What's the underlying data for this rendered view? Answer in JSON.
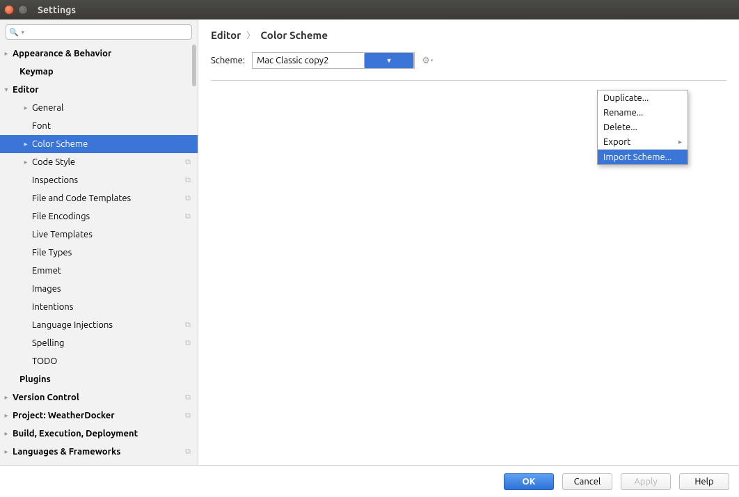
{
  "window": {
    "title": "Settings"
  },
  "sidebar": {
    "search_placeholder": "",
    "items": [
      {
        "label": "Appearance & Behavior",
        "level": 0,
        "bold": true,
        "arrow": "▸",
        "copy": false
      },
      {
        "label": "Keymap",
        "level": 1,
        "bold": true,
        "arrow": "",
        "copy": false
      },
      {
        "label": "Editor",
        "level": 0,
        "bold": true,
        "arrow": "▾",
        "copy": false
      },
      {
        "label": "General",
        "level": 2,
        "bold": false,
        "arrow": "▸",
        "copy": false
      },
      {
        "label": "Font",
        "level": 2,
        "bold": false,
        "arrow": "",
        "copy": false
      },
      {
        "label": "Color Scheme",
        "level": 2,
        "bold": false,
        "arrow": "▸",
        "copy": false,
        "selected": true
      },
      {
        "label": "Code Style",
        "level": 2,
        "bold": false,
        "arrow": "▸",
        "copy": true
      },
      {
        "label": "Inspections",
        "level": 2,
        "bold": false,
        "arrow": "",
        "copy": true
      },
      {
        "label": "File and Code Templates",
        "level": 2,
        "bold": false,
        "arrow": "",
        "copy": true
      },
      {
        "label": "File Encodings",
        "level": 2,
        "bold": false,
        "arrow": "",
        "copy": true
      },
      {
        "label": "Live Templates",
        "level": 2,
        "bold": false,
        "arrow": "",
        "copy": false
      },
      {
        "label": "File Types",
        "level": 2,
        "bold": false,
        "arrow": "",
        "copy": false
      },
      {
        "label": "Emmet",
        "level": 2,
        "bold": false,
        "arrow": "",
        "copy": false
      },
      {
        "label": "Images",
        "level": 2,
        "bold": false,
        "arrow": "",
        "copy": false
      },
      {
        "label": "Intentions",
        "level": 2,
        "bold": false,
        "arrow": "",
        "copy": false
      },
      {
        "label": "Language Injections",
        "level": 2,
        "bold": false,
        "arrow": "",
        "copy": true
      },
      {
        "label": "Spelling",
        "level": 2,
        "bold": false,
        "arrow": "",
        "copy": true
      },
      {
        "label": "TODO",
        "level": 2,
        "bold": false,
        "arrow": "",
        "copy": false
      },
      {
        "label": "Plugins",
        "level": 1,
        "bold": true,
        "arrow": "",
        "copy": false
      },
      {
        "label": "Version Control",
        "level": 0,
        "bold": true,
        "arrow": "▸",
        "copy": true
      },
      {
        "label": "Project: WeatherDocker",
        "level": 0,
        "bold": true,
        "arrow": "▸",
        "copy": true
      },
      {
        "label": "Build, Execution, Deployment",
        "level": 0,
        "bold": true,
        "arrow": "▸",
        "copy": false
      },
      {
        "label": "Languages & Frameworks",
        "level": 0,
        "bold": true,
        "arrow": "▸",
        "copy": true
      }
    ]
  },
  "main": {
    "breadcrumb": [
      "Editor",
      "Color Scheme"
    ],
    "scheme_label": "Scheme:",
    "scheme_value": "Mac Classic copy2"
  },
  "popup": {
    "items": [
      {
        "label": "Duplicate...",
        "submenu": false,
        "hl": false
      },
      {
        "label": "Rename...",
        "submenu": false,
        "hl": false
      },
      {
        "label": "Delete...",
        "submenu": false,
        "hl": false
      },
      {
        "label": "Export",
        "submenu": true,
        "hl": false
      },
      {
        "label": "Import Scheme...",
        "submenu": false,
        "hl": true
      }
    ]
  },
  "footer": {
    "ok": "OK",
    "cancel": "Cancel",
    "apply": "Apply",
    "help": "Help"
  }
}
